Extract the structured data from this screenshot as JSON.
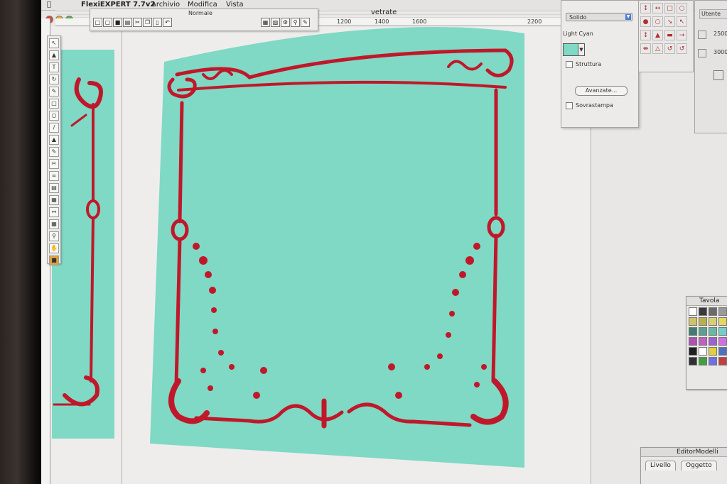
{
  "app": {
    "name": "FlexiEXPERT 7.7v2",
    "menus": [
      "Archivio",
      "Modifica",
      "Vista"
    ]
  },
  "document": {
    "title": "vetrate",
    "view_mode": "Normale",
    "ruler_ticks": [
      "1200",
      "1400",
      "1600",
      "2200"
    ]
  },
  "fill_panel": {
    "fill_type": "Solido",
    "color_name": "Light Cyan",
    "color_hex": "#7fd9c4",
    "checkbox_structure": "Struttura",
    "button_advanced": "Avanzate...",
    "checkbox_overprint": "Sovrastampa"
  },
  "size_panel": {
    "header": "Utente",
    "width_value": "2500",
    "height_value": "3000"
  },
  "tavola": {
    "title": "Tavola",
    "colors": [
      "#ffffff",
      "#3a3a3a",
      "#6b6b6b",
      "#9a9a9a",
      "#cdc36a",
      "#b8b04a",
      "#d8d070",
      "#e0d860",
      "#3e7e70",
      "#5aa090",
      "#68b8a8",
      "#70d0c8",
      "#b050b0",
      "#c060c0",
      "#a060d0",
      "#d070e0",
      "#202020",
      "#ffffff",
      "#e0d040",
      "#5070c0",
      "#303030",
      "#40a040",
      "#7070e0",
      "#c04040"
    ]
  },
  "editor_modelli": {
    "title": "EditorModelli",
    "tabs": [
      "Livello",
      "Oggetto"
    ]
  },
  "artwork": {
    "panel_color": "#7fd9c4",
    "ornament_color": "#c0182a"
  }
}
